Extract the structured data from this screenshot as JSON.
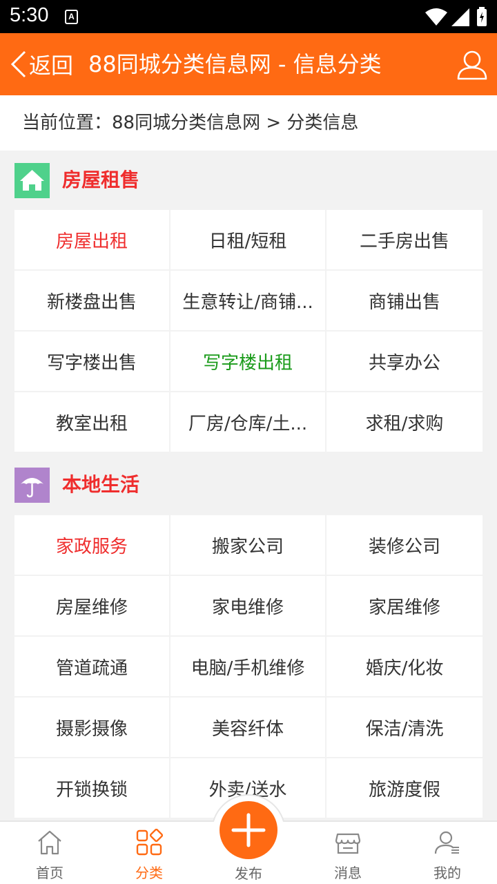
{
  "status_bar": {
    "time": "5:30",
    "notif_letter": "A"
  },
  "header": {
    "back_label": "返回",
    "title": "88同城分类信息网 - 信息分类"
  },
  "breadcrumb": "当前位置：88同城分类信息网 > 分类信息",
  "colors": {
    "accent": "#ff6a13",
    "section_title": "#ef2d2d",
    "house_icon_bg": "#4fd18b",
    "life_icon_bg": "#b084cc",
    "highlight_green": "#1a9b1a"
  },
  "sections": [
    {
      "title": "房屋租售",
      "icon": "house-icon",
      "items": [
        {
          "label": "房屋出租",
          "style": "red"
        },
        {
          "label": "日租/短租",
          "style": ""
        },
        {
          "label": "二手房出售",
          "style": ""
        },
        {
          "label": "新楼盘出售",
          "style": ""
        },
        {
          "label": "生意转让/商铺...",
          "style": ""
        },
        {
          "label": "商铺出售",
          "style": ""
        },
        {
          "label": "写字楼出售",
          "style": ""
        },
        {
          "label": "写字楼出租",
          "style": "green"
        },
        {
          "label": "共享办公",
          "style": ""
        },
        {
          "label": "教室出租",
          "style": ""
        },
        {
          "label": "厂房/仓库/土...",
          "style": ""
        },
        {
          "label": "求租/求购",
          "style": ""
        }
      ]
    },
    {
      "title": "本地生活",
      "icon": "umbrella-icon",
      "items": [
        {
          "label": "家政服务",
          "style": "red"
        },
        {
          "label": "搬家公司",
          "style": ""
        },
        {
          "label": "装修公司",
          "style": ""
        },
        {
          "label": "房屋维修",
          "style": ""
        },
        {
          "label": "家电维修",
          "style": ""
        },
        {
          "label": "家居维修",
          "style": ""
        },
        {
          "label": "管道疏通",
          "style": ""
        },
        {
          "label": "电脑/手机维修",
          "style": ""
        },
        {
          "label": "婚庆/化妆",
          "style": ""
        },
        {
          "label": "摄影摄像",
          "style": ""
        },
        {
          "label": "美容纤体",
          "style": ""
        },
        {
          "label": "保洁/清洗",
          "style": ""
        },
        {
          "label": "开锁换锁",
          "style": ""
        },
        {
          "label": "外卖/送水",
          "style": ""
        },
        {
          "label": "旅游度假",
          "style": ""
        }
      ]
    }
  ],
  "tabbar": [
    {
      "label": "首页",
      "icon": "home-icon",
      "active": false
    },
    {
      "label": "分类",
      "icon": "category-icon",
      "active": true
    },
    {
      "label": "发布",
      "icon": "plus-icon",
      "active": false
    },
    {
      "label": "消息",
      "icon": "shop-icon",
      "active": false
    },
    {
      "label": "我的",
      "icon": "profile-icon",
      "active": false
    }
  ]
}
